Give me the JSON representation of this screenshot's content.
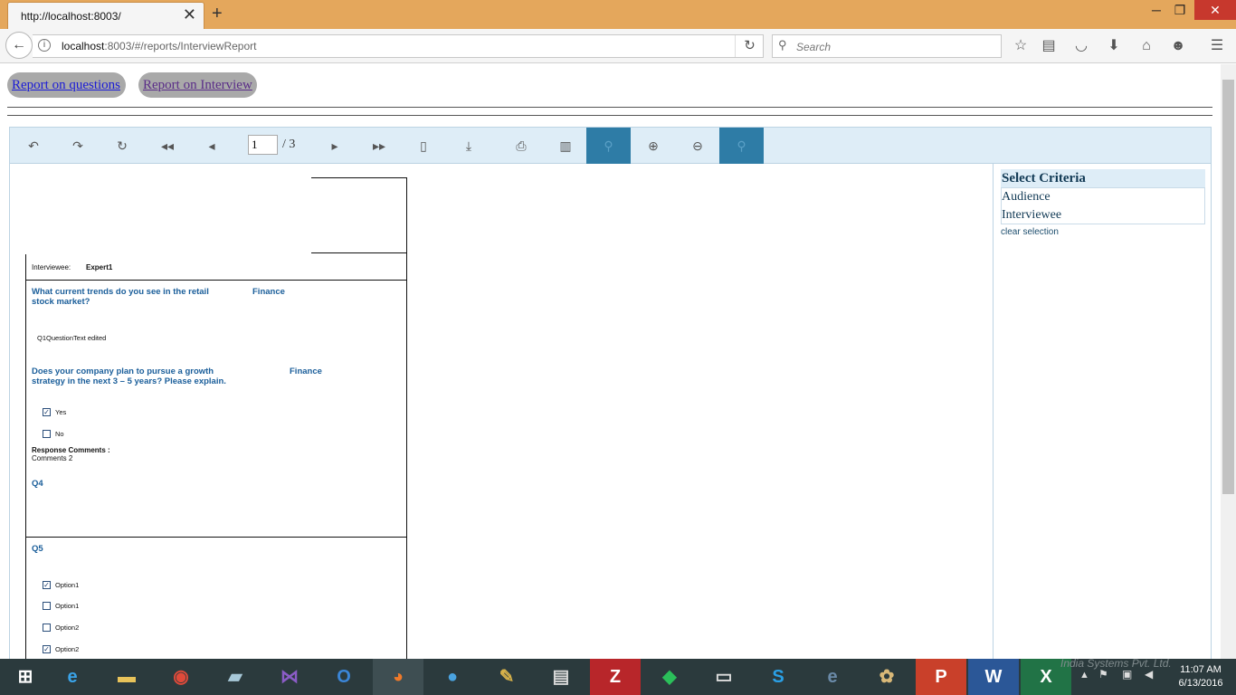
{
  "browser": {
    "tab_title": "http://localhost:8003/",
    "url_host": "localhost",
    "url_rest": ":8003/#/reports/InterviewReport",
    "search_placeholder": "Search"
  },
  "page": {
    "btn_questions": "Report on questions",
    "btn_interview": "Report on Interview"
  },
  "toolbar": {
    "current_page": "1",
    "page_total": "/ 3"
  },
  "criteria": {
    "heading": "Select Criteria",
    "items": [
      "Audience",
      "Interviewee"
    ],
    "clear": "clear selection"
  },
  "report": {
    "interviewee_label": "Interviewee:",
    "interviewee_value": "Expert1",
    "q1_line1": "What current trends do you see in the retail",
    "q1_line2": "stock market?",
    "q1_category": "Finance",
    "q1_answer": "Q1QuestionText edited",
    "q2_line1": "Does your company plan to pursue a growth",
    "q2_line2": "strategy in the next 3 – 5 years? Please explain.",
    "q2_category": "Finance",
    "q2_options": [
      {
        "label": "Yes",
        "checked": true
      },
      {
        "label": "No",
        "checked": false
      }
    ],
    "response_comments_label": "Response Comments :",
    "response_comments_value": "Comments 2",
    "q4": "Q4",
    "q5": "Q5",
    "q5_options": [
      {
        "label": "Option1",
        "checked": true
      },
      {
        "label": "Option1",
        "checked": false
      },
      {
        "label": "Option2",
        "checked": false
      },
      {
        "label": "Option2",
        "checked": true
      }
    ]
  },
  "taskbar": {
    "time": "11:07 AM",
    "date": "6/13/2016",
    "watermark": "India Systems Pvt. Ltd."
  },
  "colors": {
    "titlebar": "#e4a75c",
    "toolbar_bg": "#deedf7",
    "toolbar_active": "#2e7ca6",
    "question_text": "#1a5e9a",
    "taskbar": "#2b3a3d"
  }
}
